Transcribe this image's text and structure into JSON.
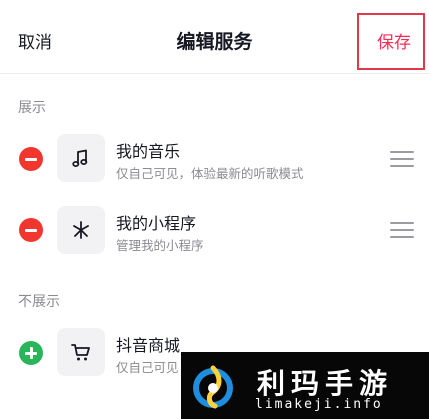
{
  "nav": {
    "cancel": "取消",
    "title": "编辑服务",
    "save": "保存"
  },
  "sections": {
    "shown": "展示",
    "hidden": "不展示"
  },
  "items": [
    {
      "title": "我的音乐",
      "subtitle": "仅自己可见，体验最新的听歌模式",
      "icon": "music-note-icon",
      "action": "remove"
    },
    {
      "title": "我的小程序",
      "subtitle": "管理我的小程序",
      "icon": "mini-program-icon",
      "action": "remove"
    },
    {
      "title": "抖音商城",
      "subtitle": "仅自己可见",
      "icon": "shopping-cart-icon",
      "action": "add"
    }
  ],
  "watermark": {
    "title": "利玛手游",
    "url": "limakeji.info"
  },
  "colors": {
    "accent": "#fe2c55",
    "remove": "#f0362f",
    "add": "#2bb55a",
    "highlight_box": "#e0394b"
  }
}
